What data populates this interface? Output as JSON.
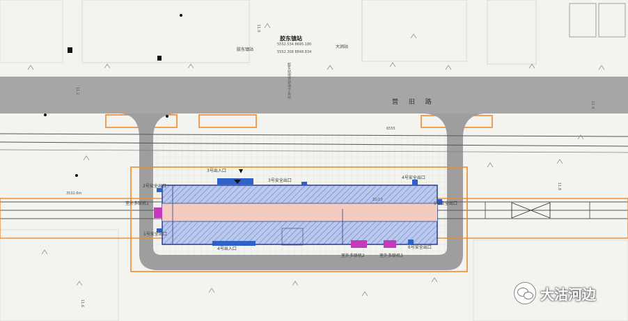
{
  "road": {
    "name": "营 旧 路"
  },
  "station": {
    "name": "胶东镇站",
    "coords": [
      "5552.534 8695.180",
      "5552.308 8848.834"
    ],
    "platform_label": "Z1/13"
  },
  "map_labels": {
    "neighbor_left": "胶东镇站",
    "neighbor_right": "大涧站",
    "vertical_text": "胶东站地铁站/地下车站",
    "small_num": "6555",
    "small_label": "3532.6m",
    "scale_texts": [
      "11.2",
      "11.9",
      "11.4",
      "11.6",
      "11.8"
    ]
  },
  "entrances": {
    "exit3": "3号出入口",
    "exit4": "4号出入口",
    "safety2": "2号安全出口",
    "safety3": "3号安全出口",
    "safety4": "4号安全出口",
    "safety1": "1号安全出口",
    "safety5": "5号安全出口",
    "safety6": "6号安全出口",
    "wind1": "室外多联机1",
    "wind2": "室外多联机2",
    "wind3": "室外多联机3"
  },
  "watermark": {
    "text": "大沽河边",
    "icon": "wechat-icon"
  },
  "colors": {
    "road": "#a6a6a6",
    "loop_road": "#9e9e9e",
    "boundary": "#f08a2c",
    "station_fill": "#b9c8ec",
    "hatch": "#6c86c8",
    "platform": "#f3cbbf",
    "station_outline": "#2a3d8a",
    "entrance": "#2f62c9",
    "vent": "#c33bbc"
  }
}
